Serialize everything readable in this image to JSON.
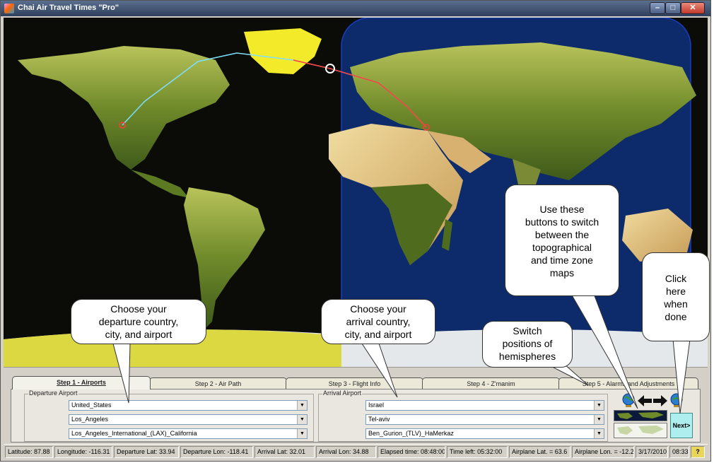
{
  "window": {
    "title": "Chai Air Travel Times \"Pro\""
  },
  "colors": {
    "title_bar": "#3b4d6b",
    "map_background": "#0b0b08",
    "next_button": "#aeeeee",
    "panel": "#d4d0c8"
  },
  "tabs": [
    {
      "label": "Step 1 - Airports",
      "active": true
    },
    {
      "label": "Step 2 - Air Path"
    },
    {
      "label": "Step 3 - Flight Info"
    },
    {
      "label": "Step 4 - Z'manim"
    },
    {
      "label": "Step 5 - Alarms and Adjustments"
    }
  ],
  "departure": {
    "group_label": "Departure Airport",
    "country": "United_States",
    "city": "Los_Angeles",
    "airport": "Los_Angeles_International_(LAX)_California"
  },
  "arrival": {
    "group_label": "Arrival Airport",
    "country": "Israel",
    "city": "Tel-aviv",
    "airport": "Ben_Gurion_(TLV)_HaMerkaz"
  },
  "buttons": {
    "next": "Next>",
    "icons": [
      "globe-icon",
      "arrow-left-icon",
      "arrow-right-icon",
      "globe-icon",
      "map-thumbnail",
      "help-icon"
    ]
  },
  "callouts": {
    "departure": [
      "Choose your",
      "departure country,",
      "city, and airport"
    ],
    "arrival": [
      "Choose your",
      "arrival country,",
      "city, and airport"
    ],
    "switch": [
      "Switch",
      "positions of",
      "hemispheres"
    ],
    "maps": [
      "Use these",
      "buttons to switch",
      "between the",
      "topographical",
      "and time zone",
      "maps"
    ],
    "done": [
      "Click",
      "here",
      "when",
      "done"
    ]
  },
  "status": {
    "latitude": "Latitude: 87.88",
    "longitude": "Longitude: -116.31",
    "dep_lat": "Departure Lat: 33.94",
    "dep_lon": "Departure Lon: -118.41",
    "arr_lat": "Arrival Lat: 32.01",
    "arr_lon": "Arrival Lon: 34.88",
    "elapsed": "Elapsed time: 08:48:00",
    "time_left": "Time left: 05:32:00",
    "plane_lat": "Airplane Lat. = 63.6",
    "plane_lon": "Airplane Lon. = -12.2",
    "date": "3/17/2010",
    "time": "08:33"
  }
}
